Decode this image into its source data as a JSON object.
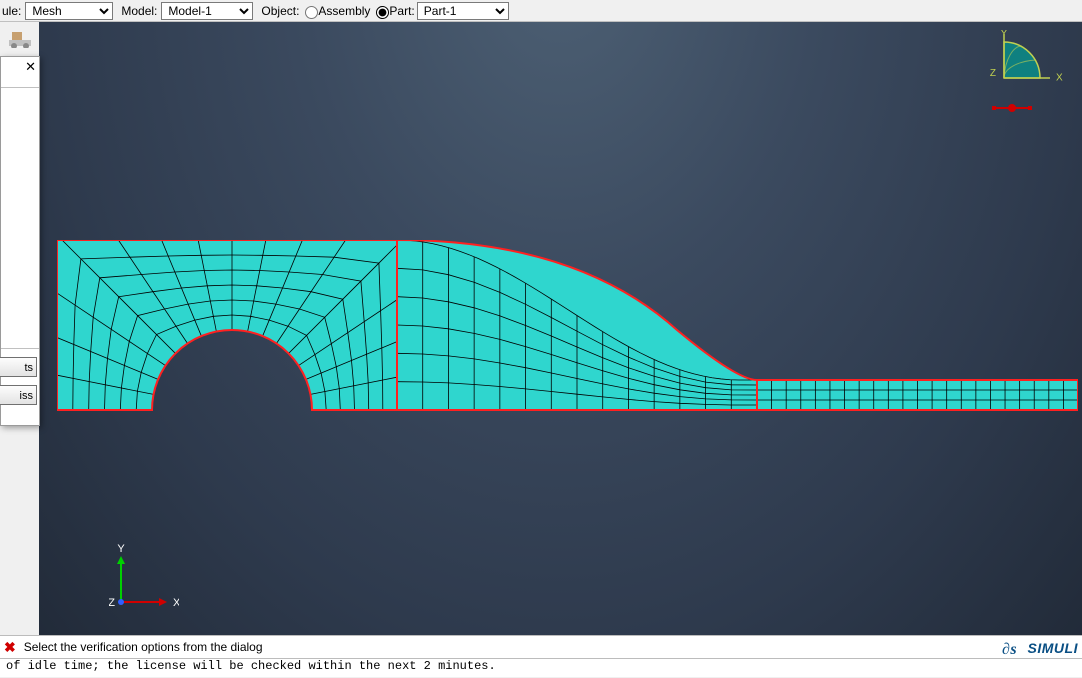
{
  "context_bar": {
    "module_label": "ule:",
    "module_value": "Mesh",
    "model_label": "Model:",
    "model_value": "Model-1",
    "object_label": "Object:",
    "radio_assembly_label": "Assembly",
    "radio_assembly_checked": false,
    "radio_part_label": "Part:",
    "radio_part_checked": true,
    "part_value": "Part-1"
  },
  "dialog": {
    "close": "✕",
    "btn1": "ts",
    "btn2": "iss"
  },
  "compass": {
    "y_label": "Y",
    "x_label": "X",
    "z_label": "Z"
  },
  "triad": {
    "y_label": "Y",
    "x_label": "X",
    "z_label": "Z"
  },
  "prompt": {
    "text": "Select the verification options from the dialog"
  },
  "brand": {
    "text": "SIMULI"
  },
  "message": {
    "text": "of idle time; the license will be checked within the next 2 minutes."
  }
}
